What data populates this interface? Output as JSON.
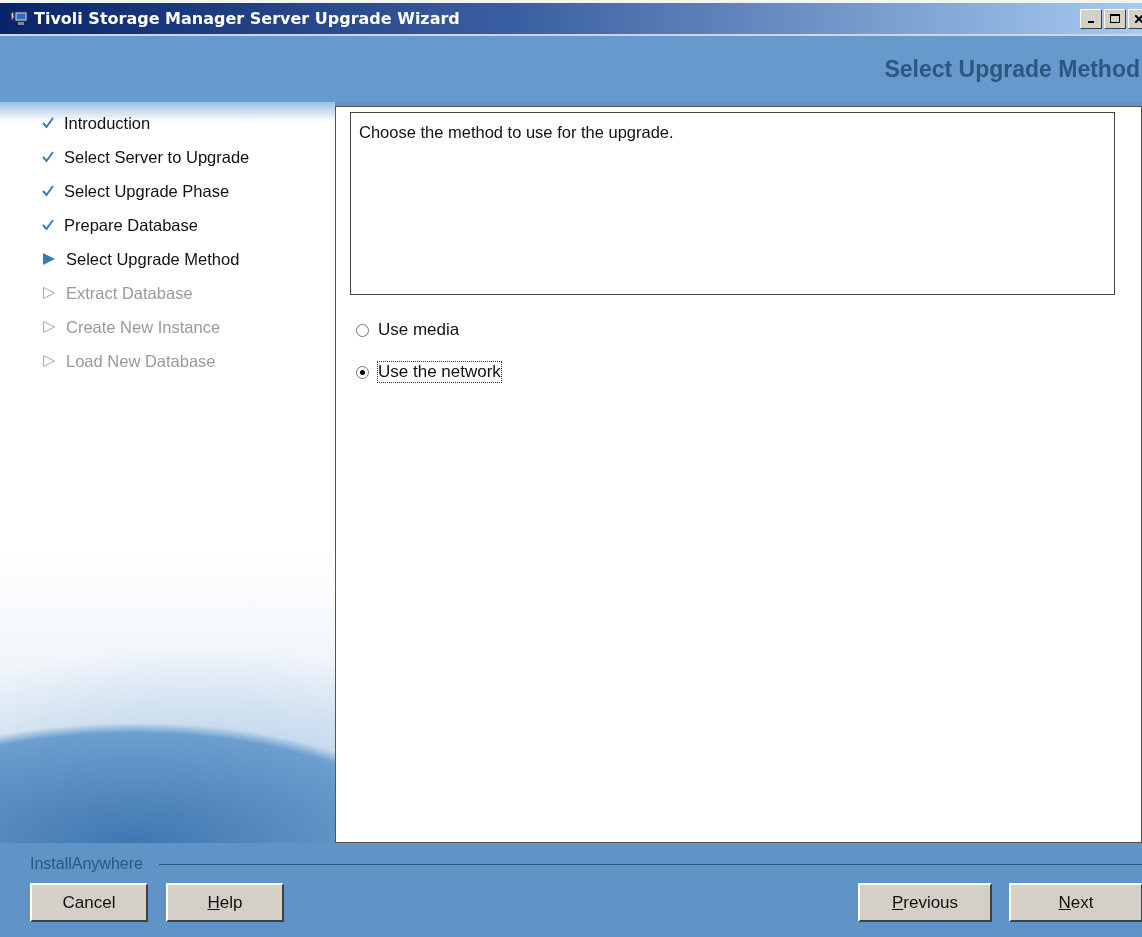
{
  "window": {
    "title": "Tivoli Storage Manager Server Upgrade Wizard"
  },
  "header": {
    "title": "Select Upgrade Method"
  },
  "steps": [
    {
      "label": "Introduction",
      "kind": "done"
    },
    {
      "label": "Select Server to Upgrade",
      "kind": "done"
    },
    {
      "label": "Select Upgrade Phase",
      "kind": "done"
    },
    {
      "label": "Prepare Database",
      "kind": "done"
    },
    {
      "label": "Select Upgrade Method",
      "kind": "current"
    },
    {
      "label": "Extract Database",
      "kind": "pending"
    },
    {
      "label": "Create New Instance",
      "kind": "pending"
    },
    {
      "label": "Load New Database",
      "kind": "pending"
    }
  ],
  "description": "Choose the method to use for the upgrade.",
  "options": [
    {
      "label": "Use media",
      "selected": false
    },
    {
      "label": "Use the network",
      "selected": true
    }
  ],
  "footer": {
    "brand": "InstallAnywhere"
  },
  "buttons_left": [
    {
      "label": "Cancel",
      "underline_first": false
    },
    {
      "label": "Help",
      "underline_first": true
    }
  ],
  "buttons_right": [
    {
      "label": "Previous",
      "underline_first": true
    },
    {
      "label": "Next",
      "underline_first": true
    }
  ]
}
